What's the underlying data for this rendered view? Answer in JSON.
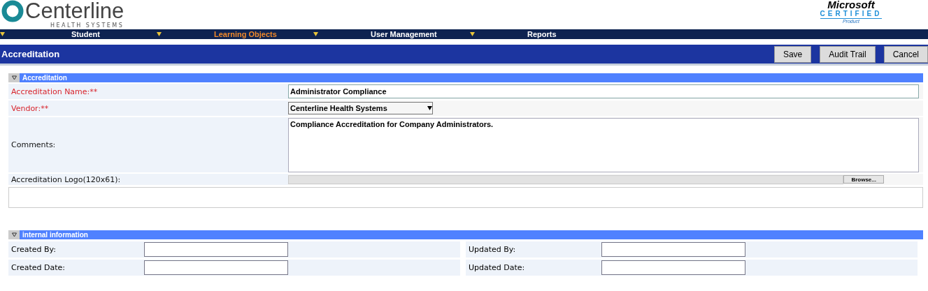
{
  "header": {
    "logo_name": "Centerline",
    "logo_tagline": "HEALTH SYSTEMS",
    "badge_brand": "Microsoft",
    "badge_title": "CERTIFIED",
    "badge_sub": "Product"
  },
  "nav": [
    {
      "label": "Student",
      "selected": false
    },
    {
      "label": "Learning Objects",
      "selected": true
    },
    {
      "label": "User Management",
      "selected": false
    },
    {
      "label": "Reports",
      "selected": false
    }
  ],
  "page_title": "Accreditation",
  "buttons": [
    "Save",
    "Audit Trail",
    "Cancel"
  ],
  "section": {
    "title": "Accreditation",
    "expanded": true,
    "fields": [
      {
        "kind": "text",
        "label": "Accreditation Name:**",
        "required": true,
        "value": "Administrator Compliance"
      },
      {
        "kind": "select",
        "label": "Vendor:**",
        "required": true,
        "value": "Centerline Health Systems"
      },
      {
        "kind": "textarea",
        "label": "Comments:",
        "required": false,
        "value": "Compliance Accreditation for Company Administrators."
      },
      {
        "kind": "file",
        "label": "Accreditation Logo(120x61):",
        "required": false,
        "button": "Browse..."
      }
    ]
  },
  "internal": {
    "title": "internal information",
    "expanded": true,
    "rows": [
      [
        {
          "label": "Created By:"
        },
        {
          "label": "Updated By:"
        }
      ],
      [
        {
          "label": "Created Date:"
        },
        {
          "label": "Updated Date:"
        }
      ]
    ]
  }
}
